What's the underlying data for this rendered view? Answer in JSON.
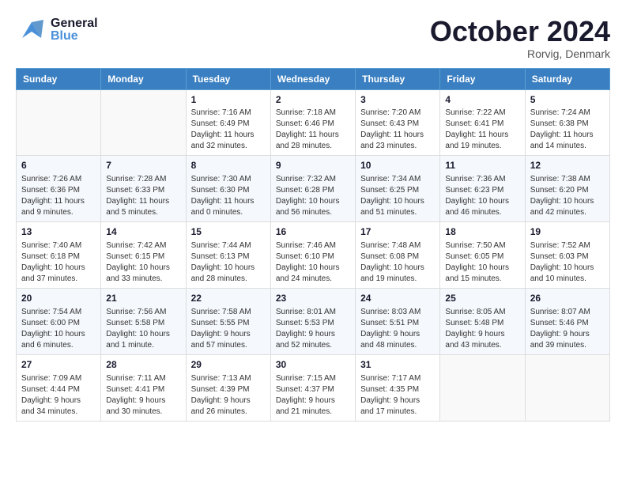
{
  "header": {
    "logo_general": "General",
    "logo_blue": "Blue",
    "month_title": "October 2024",
    "location": "Rorvig, Denmark"
  },
  "days_of_week": [
    "Sunday",
    "Monday",
    "Tuesday",
    "Wednesday",
    "Thursday",
    "Friday",
    "Saturday"
  ],
  "weeks": [
    [
      {
        "day": "",
        "sunrise": "",
        "sunset": "",
        "daylight": ""
      },
      {
        "day": "",
        "sunrise": "",
        "sunset": "",
        "daylight": ""
      },
      {
        "day": "1",
        "sunrise": "Sunrise: 7:16 AM",
        "sunset": "Sunset: 6:49 PM",
        "daylight": "Daylight: 11 hours and 32 minutes."
      },
      {
        "day": "2",
        "sunrise": "Sunrise: 7:18 AM",
        "sunset": "Sunset: 6:46 PM",
        "daylight": "Daylight: 11 hours and 28 minutes."
      },
      {
        "day": "3",
        "sunrise": "Sunrise: 7:20 AM",
        "sunset": "Sunset: 6:43 PM",
        "daylight": "Daylight: 11 hours and 23 minutes."
      },
      {
        "day": "4",
        "sunrise": "Sunrise: 7:22 AM",
        "sunset": "Sunset: 6:41 PM",
        "daylight": "Daylight: 11 hours and 19 minutes."
      },
      {
        "day": "5",
        "sunrise": "Sunrise: 7:24 AM",
        "sunset": "Sunset: 6:38 PM",
        "daylight": "Daylight: 11 hours and 14 minutes."
      }
    ],
    [
      {
        "day": "6",
        "sunrise": "Sunrise: 7:26 AM",
        "sunset": "Sunset: 6:36 PM",
        "daylight": "Daylight: 11 hours and 9 minutes."
      },
      {
        "day": "7",
        "sunrise": "Sunrise: 7:28 AM",
        "sunset": "Sunset: 6:33 PM",
        "daylight": "Daylight: 11 hours and 5 minutes."
      },
      {
        "day": "8",
        "sunrise": "Sunrise: 7:30 AM",
        "sunset": "Sunset: 6:30 PM",
        "daylight": "Daylight: 11 hours and 0 minutes."
      },
      {
        "day": "9",
        "sunrise": "Sunrise: 7:32 AM",
        "sunset": "Sunset: 6:28 PM",
        "daylight": "Daylight: 10 hours and 56 minutes."
      },
      {
        "day": "10",
        "sunrise": "Sunrise: 7:34 AM",
        "sunset": "Sunset: 6:25 PM",
        "daylight": "Daylight: 10 hours and 51 minutes."
      },
      {
        "day": "11",
        "sunrise": "Sunrise: 7:36 AM",
        "sunset": "Sunset: 6:23 PM",
        "daylight": "Daylight: 10 hours and 46 minutes."
      },
      {
        "day": "12",
        "sunrise": "Sunrise: 7:38 AM",
        "sunset": "Sunset: 6:20 PM",
        "daylight": "Daylight: 10 hours and 42 minutes."
      }
    ],
    [
      {
        "day": "13",
        "sunrise": "Sunrise: 7:40 AM",
        "sunset": "Sunset: 6:18 PM",
        "daylight": "Daylight: 10 hours and 37 minutes."
      },
      {
        "day": "14",
        "sunrise": "Sunrise: 7:42 AM",
        "sunset": "Sunset: 6:15 PM",
        "daylight": "Daylight: 10 hours and 33 minutes."
      },
      {
        "day": "15",
        "sunrise": "Sunrise: 7:44 AM",
        "sunset": "Sunset: 6:13 PM",
        "daylight": "Daylight: 10 hours and 28 minutes."
      },
      {
        "day": "16",
        "sunrise": "Sunrise: 7:46 AM",
        "sunset": "Sunset: 6:10 PM",
        "daylight": "Daylight: 10 hours and 24 minutes."
      },
      {
        "day": "17",
        "sunrise": "Sunrise: 7:48 AM",
        "sunset": "Sunset: 6:08 PM",
        "daylight": "Daylight: 10 hours and 19 minutes."
      },
      {
        "day": "18",
        "sunrise": "Sunrise: 7:50 AM",
        "sunset": "Sunset: 6:05 PM",
        "daylight": "Daylight: 10 hours and 15 minutes."
      },
      {
        "day": "19",
        "sunrise": "Sunrise: 7:52 AM",
        "sunset": "Sunset: 6:03 PM",
        "daylight": "Daylight: 10 hours and 10 minutes."
      }
    ],
    [
      {
        "day": "20",
        "sunrise": "Sunrise: 7:54 AM",
        "sunset": "Sunset: 6:00 PM",
        "daylight": "Daylight: 10 hours and 6 minutes."
      },
      {
        "day": "21",
        "sunrise": "Sunrise: 7:56 AM",
        "sunset": "Sunset: 5:58 PM",
        "daylight": "Daylight: 10 hours and 1 minute."
      },
      {
        "day": "22",
        "sunrise": "Sunrise: 7:58 AM",
        "sunset": "Sunset: 5:55 PM",
        "daylight": "Daylight: 9 hours and 57 minutes."
      },
      {
        "day": "23",
        "sunrise": "Sunrise: 8:01 AM",
        "sunset": "Sunset: 5:53 PM",
        "daylight": "Daylight: 9 hours and 52 minutes."
      },
      {
        "day": "24",
        "sunrise": "Sunrise: 8:03 AM",
        "sunset": "Sunset: 5:51 PM",
        "daylight": "Daylight: 9 hours and 48 minutes."
      },
      {
        "day": "25",
        "sunrise": "Sunrise: 8:05 AM",
        "sunset": "Sunset: 5:48 PM",
        "daylight": "Daylight: 9 hours and 43 minutes."
      },
      {
        "day": "26",
        "sunrise": "Sunrise: 8:07 AM",
        "sunset": "Sunset: 5:46 PM",
        "daylight": "Daylight: 9 hours and 39 minutes."
      }
    ],
    [
      {
        "day": "27",
        "sunrise": "Sunrise: 7:09 AM",
        "sunset": "Sunset: 4:44 PM",
        "daylight": "Daylight: 9 hours and 34 minutes."
      },
      {
        "day": "28",
        "sunrise": "Sunrise: 7:11 AM",
        "sunset": "Sunset: 4:41 PM",
        "daylight": "Daylight: 9 hours and 30 minutes."
      },
      {
        "day": "29",
        "sunrise": "Sunrise: 7:13 AM",
        "sunset": "Sunset: 4:39 PM",
        "daylight": "Daylight: 9 hours and 26 minutes."
      },
      {
        "day": "30",
        "sunrise": "Sunrise: 7:15 AM",
        "sunset": "Sunset: 4:37 PM",
        "daylight": "Daylight: 9 hours and 21 minutes."
      },
      {
        "day": "31",
        "sunrise": "Sunrise: 7:17 AM",
        "sunset": "Sunset: 4:35 PM",
        "daylight": "Daylight: 9 hours and 17 minutes."
      },
      {
        "day": "",
        "sunrise": "",
        "sunset": "",
        "daylight": ""
      },
      {
        "day": "",
        "sunrise": "",
        "sunset": "",
        "daylight": ""
      }
    ]
  ]
}
